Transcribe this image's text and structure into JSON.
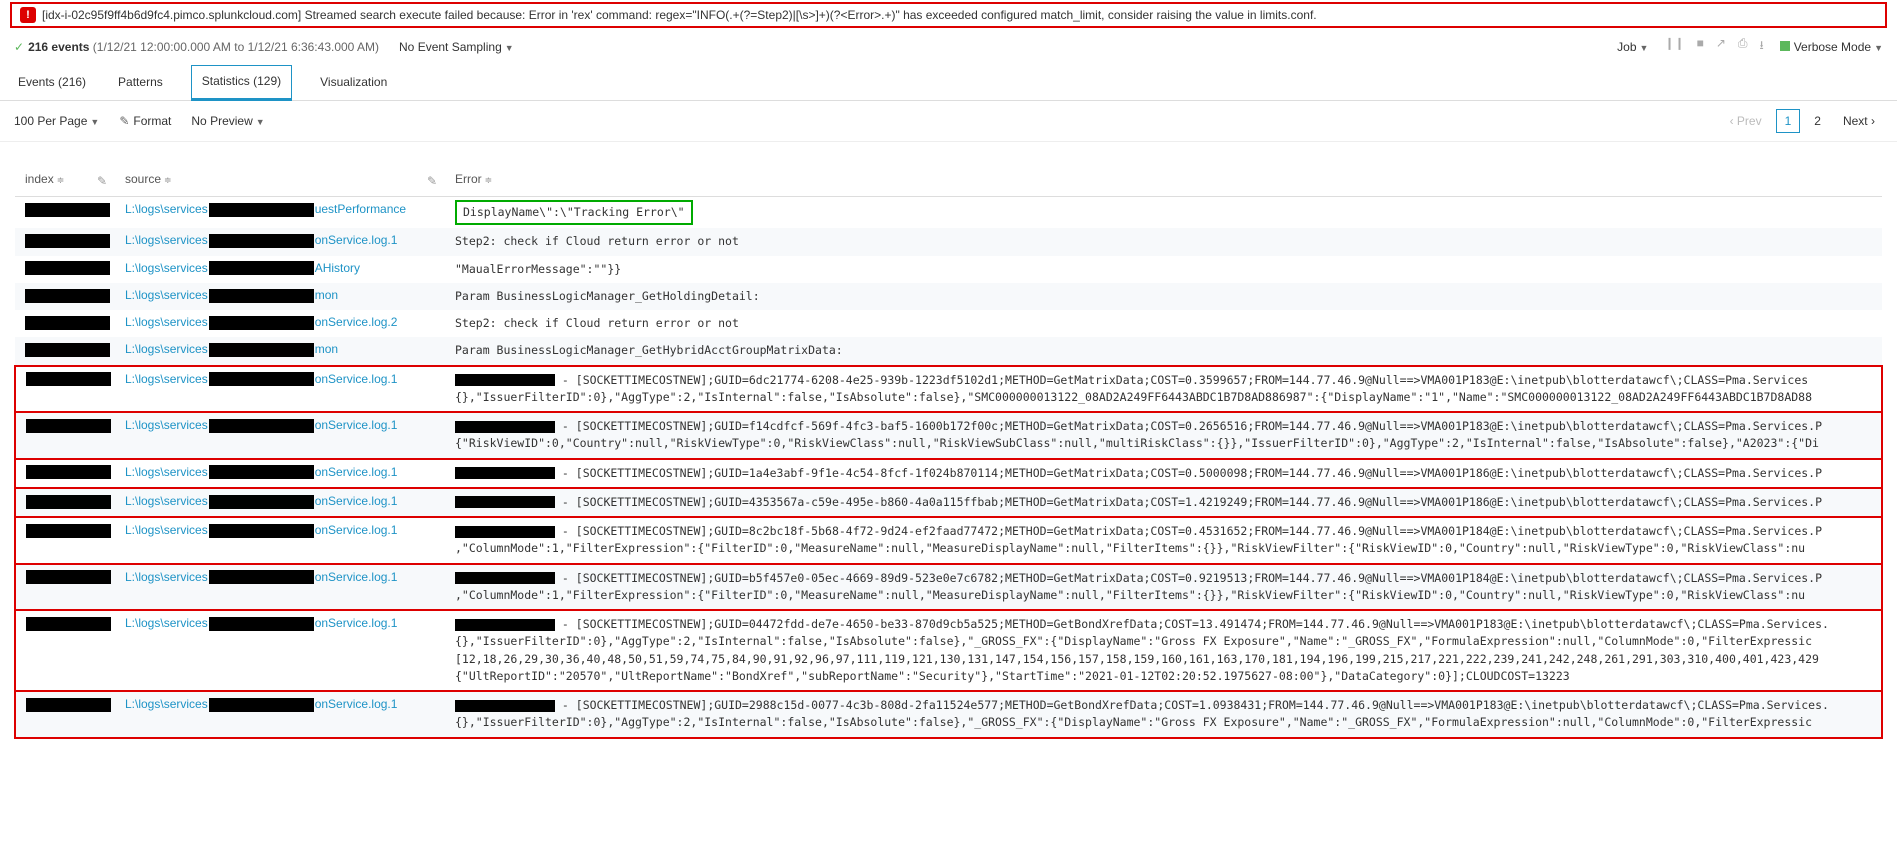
{
  "error_banner": "[idx-i-02c95f9ff4b6d9fc4.pimco.splunkcloud.com] Streamed search execute failed because: Error in 'rex' command: regex=\"INFO(.+(?=Step2)|[\\s>]+)(?<Error>.+)\" has exceeded configured match_limit, consider raising the value in limits.conf.",
  "events_count": "216 events",
  "timerange": "(1/12/21 12:00:00.000 AM to 1/12/21 6:36:43.000 AM)",
  "sampling": "No Event Sampling",
  "job_label": "Job",
  "verbose_label": "Verbose Mode",
  "tabs": {
    "events": "Events (216)",
    "patterns": "Patterns",
    "statistics": "Statistics (129)",
    "visualization": "Visualization"
  },
  "per_page": "100 Per Page",
  "format": "Format",
  "preview": "No Preview",
  "pager": {
    "prev": "Prev",
    "p1": "1",
    "p2": "2",
    "next": "Next"
  },
  "headers": {
    "index": "index",
    "source": "source",
    "error": "Error"
  },
  "src": {
    "pre": "L:\\logs\\services",
    "s1": "uestPerformance",
    "s2": "onService.log.1",
    "s3": "AHistory",
    "s4": "mon",
    "s5": "onService.log.2"
  },
  "err": {
    "r1": "DisplayName\\\":\\\"Tracking Error\\\"",
    "r2": "Step2: check if Cloud return error or not",
    "r3": "\"MaualErrorMessage\":\"\"}}",
    "r4": "Param BusinessLogicManager_GetHoldingDetail:",
    "r5": "Step2: check if Cloud return error or not",
    "r6": "Param BusinessLogicManager_GetHybridAcctGroupMatrixData:",
    "r7": " - [SOCKETTIMECOSTNEW];GUID=6dc21774-6208-4e25-939b-1223df5102d1;METHOD=GetMatrixData;COST=0.3599657;FROM=144.77.46.9@Null==>VMA001P183@E:\\inetpub\\blotterdatawcf\\;CLASS=Pma.Services\n{},\"IssuerFilterID\":0},\"AggType\":2,\"IsInternal\":false,\"IsAbsolute\":false},\"SMC000000013122_08AD2A249FF6443ABDC1B7D8AD886987\":{\"DisplayName\":\"1\",\"Name\":\"SMC000000013122_08AD2A249FF6443ABDC1B7D8AD88",
    "r8": " - [SOCKETTIMECOSTNEW];GUID=f14cdfcf-569f-4fc3-baf5-1600b172f00c;METHOD=GetMatrixData;COST=0.2656516;FROM=144.77.46.9@Null==>VMA001P183@E:\\inetpub\\blotterdatawcf\\;CLASS=Pma.Services.P\n{\"RiskViewID\":0,\"Country\":null,\"RiskViewType\":0,\"RiskViewClass\":null,\"RiskViewSubClass\":null,\"multiRiskClass\":{}},\"IssuerFilterID\":0},\"AggType\":2,\"IsInternal\":false,\"IsAbsolute\":false},\"A2023\":{\"Di",
    "r9": " - [SOCKETTIMECOSTNEW];GUID=1a4e3abf-9f1e-4c54-8fcf-1f024b870114;METHOD=GetMatrixData;COST=0.5000098;FROM=144.77.46.9@Null==>VMA001P186@E:\\inetpub\\blotterdatawcf\\;CLASS=Pma.Services.P",
    "r10": " - [SOCKETTIMECOSTNEW];GUID=4353567a-c59e-495e-b860-4a0a115ffbab;METHOD=GetMatrixData;COST=1.4219249;FROM=144.77.46.9@Null==>VMA001P186@E:\\inetpub\\blotterdatawcf\\;CLASS=Pma.Services.P",
    "r11": " - [SOCKETTIMECOSTNEW];GUID=8c2bc18f-5b68-4f72-9d24-ef2faad77472;METHOD=GetMatrixData;COST=0.4531652;FROM=144.77.46.9@Null==>VMA001P184@E:\\inetpub\\blotterdatawcf\\;CLASS=Pma.Services.P\n,\"ColumnMode\":1,\"FilterExpression\":{\"FilterID\":0,\"MeasureName\":null,\"MeasureDisplayName\":null,\"FilterItems\":{}},\"RiskViewFilter\":{\"RiskViewID\":0,\"Country\":null,\"RiskViewType\":0,\"RiskViewClass\":nu",
    "r12": " - [SOCKETTIMECOSTNEW];GUID=b5f457e0-05ec-4669-89d9-523e0e7c6782;METHOD=GetMatrixData;COST=0.9219513;FROM=144.77.46.9@Null==>VMA001P184@E:\\inetpub\\blotterdatawcf\\;CLASS=Pma.Services.P\n,\"ColumnMode\":1,\"FilterExpression\":{\"FilterID\":0,\"MeasureName\":null,\"MeasureDisplayName\":null,\"FilterItems\":{}},\"RiskViewFilter\":{\"RiskViewID\":0,\"Country\":null,\"RiskViewType\":0,\"RiskViewClass\":nu",
    "r13": " - [SOCKETTIMECOSTNEW];GUID=04472fdd-de7e-4650-be33-870d9cb5a525;METHOD=GetBondXrefData;COST=13.491474;FROM=144.77.46.9@Null==>VMA001P183@E:\\inetpub\\blotterdatawcf\\;CLASS=Pma.Services.\n{},\"IssuerFilterID\":0},\"AggType\":2,\"IsInternal\":false,\"IsAbsolute\":false},\"_GROSS_FX\":{\"DisplayName\":\"Gross FX Exposure\",\"Name\":\"_GROSS_FX\",\"FormulaExpression\":null,\"ColumnMode\":0,\"FilterExpressic\n[12,18,26,29,30,36,40,48,50,51,59,74,75,84,90,91,92,96,97,111,119,121,130,131,147,154,156,157,158,159,160,161,163,170,181,194,196,199,215,217,221,222,239,241,242,248,261,291,303,310,400,401,423,429\n{\"UltReportID\":\"20570\",\"UltReportName\":\"BondXref\",\"subReportName\":\"Security\"},\"StartTime\":\"2021-01-12T02:20:52.1975627-08:00\"},\"DataCategory\":0}];CLOUDCOST=13223",
    "r14": " - [SOCKETTIMECOSTNEW];GUID=2988c15d-0077-4c3b-808d-2fa11524e577;METHOD=GetBondXrefData;COST=1.0938431;FROM=144.77.46.9@Null==>VMA001P183@E:\\inetpub\\blotterdatawcf\\;CLASS=Pma.Services.\n{},\"IssuerFilterID\":0},\"AggType\":2,\"IsInternal\":false,\"IsAbsolute\":false},\"_GROSS_FX\":{\"DisplayName\":\"Gross FX Exposure\",\"Name\":\"_GROSS_FX\",\"FormulaExpression\":null,\"ColumnMode\":0,\"FilterExpressic"
  }
}
